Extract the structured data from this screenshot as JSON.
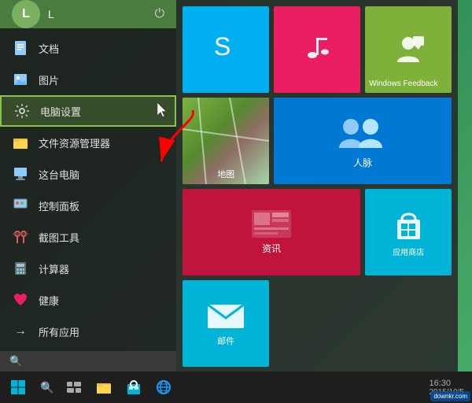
{
  "desktop": {
    "background": "green gradient"
  },
  "user": {
    "avatar": "L",
    "name": "L"
  },
  "power_button": "⏻",
  "menu_items": [
    {
      "id": "documents",
      "label": "文档",
      "icon": "📄"
    },
    {
      "id": "pictures",
      "label": "图片",
      "icon": "🖼"
    },
    {
      "id": "pc-settings",
      "label": "电脑设置",
      "icon": "⚙",
      "active": true
    },
    {
      "id": "file-explorer",
      "label": "文件资源管理器",
      "icon": "📁"
    },
    {
      "id": "this-pc",
      "label": "这台电脑",
      "icon": "🖥"
    },
    {
      "id": "control-panel",
      "label": "控制面板",
      "icon": "🖥"
    },
    {
      "id": "snipping",
      "label": "截图工具",
      "icon": "✂"
    },
    {
      "id": "calculator",
      "label": "计算器",
      "icon": "🖩"
    },
    {
      "id": "health",
      "label": "健康",
      "icon": "❤"
    },
    {
      "id": "all-apps",
      "label": "所有应用",
      "icon": "→"
    }
  ],
  "search": {
    "placeholder": "",
    "icon": "🔍"
  },
  "tiles": [
    {
      "id": "skype",
      "label": "Skype",
      "color": "#00aff0",
      "icon": "skype"
    },
    {
      "id": "music",
      "label": "",
      "color": "#e91e63",
      "icon": "music"
    },
    {
      "id": "feedback",
      "label": "Windows Feedback",
      "color": "#7fb03a",
      "icon": "feedback",
      "size": "small"
    },
    {
      "id": "maps",
      "label": "地图",
      "color": "#7fb03a",
      "icon": "maps",
      "size": "small"
    },
    {
      "id": "people",
      "label": "人脉",
      "color": "#0078d4",
      "icon": "people",
      "size": "wide"
    },
    {
      "id": "news",
      "label": "资讯",
      "color": "#c0143c",
      "icon": "news",
      "size": "wide"
    },
    {
      "id": "store",
      "label": "应用商店",
      "color": "#00b4d8",
      "icon": "store",
      "size": "small"
    },
    {
      "id": "mail",
      "label": "邮件",
      "color": "#00b4d8",
      "icon": "mail",
      "size": "small"
    }
  ],
  "taskbar": {
    "start_label": "Start",
    "items": [
      "文件管理器",
      "应用商店",
      "Internet Explorer"
    ],
    "time": "16:30",
    "date": "2015/10/5"
  },
  "watermark": {
    "site": "downkr.com"
  }
}
